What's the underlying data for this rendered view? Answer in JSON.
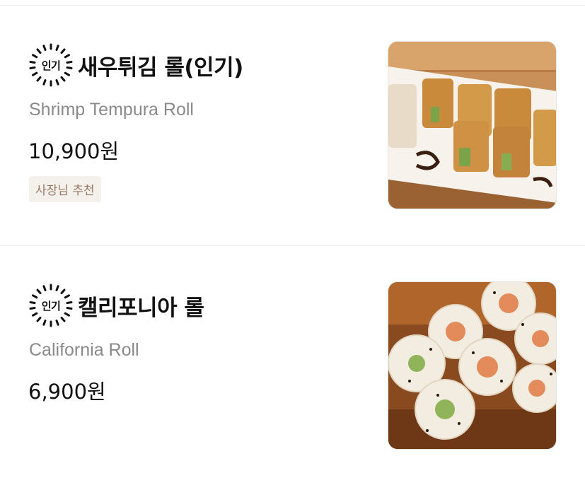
{
  "menu": {
    "items": [
      {
        "badge": "인기",
        "name": "새우튀김 롤(인기)",
        "english_name": "Shrimp Tempura Roll",
        "price": "10,900원",
        "tag": "사장님 추천",
        "image_icon": "shrimp-tempura-roll-photo"
      },
      {
        "badge": "인기",
        "name": "캘리포니아 롤",
        "english_name": "California Roll",
        "price": "6,900원",
        "image_icon": "california-roll-photo"
      }
    ]
  },
  "colors": {
    "tag_background": "#f4f0ec",
    "tag_text": "#9a7a66",
    "subtitle_text": "#8a8a8a",
    "divider": "#ececec"
  }
}
